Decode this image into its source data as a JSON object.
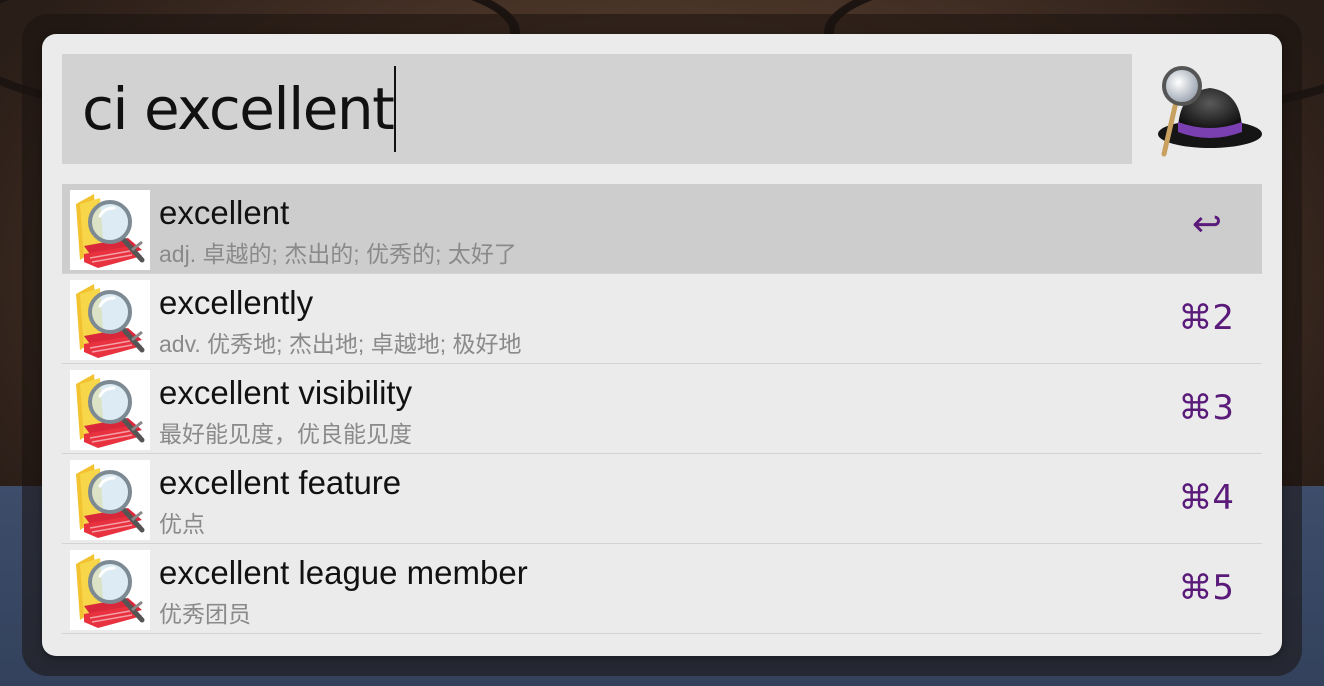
{
  "search": {
    "query": "ci excellent"
  },
  "app_logo": {
    "icon": "alfred-hat-icon"
  },
  "results": [
    {
      "title": "excellent",
      "subtitle": "adj. 卓越的; 杰出的; 优秀的; 太好了",
      "shortcut": "↩",
      "selected": true,
      "icon": "dictionary-icon"
    },
    {
      "title": "excellently",
      "subtitle": "adv. 优秀地; 杰出地; 卓越地; 极好地",
      "shortcut": "⌘2",
      "selected": false,
      "icon": "dictionary-icon"
    },
    {
      "title": "excellent visibility",
      "subtitle": "最好能见度，优良能见度",
      "shortcut": "⌘3",
      "selected": false,
      "icon": "dictionary-icon"
    },
    {
      "title": "excellent feature",
      "subtitle": "优点",
      "shortcut": "⌘4",
      "selected": false,
      "icon": "dictionary-icon"
    },
    {
      "title": "excellent league member",
      "subtitle": "优秀团员",
      "shortcut": "⌘5",
      "selected": false,
      "icon": "dictionary-icon"
    }
  ],
  "colors": {
    "window_bg": "#ebebeb",
    "search_bg": "#d2d2d2",
    "selected_row_bg": "#cdcdcd",
    "shortcut": "#5a1a7a",
    "subtitle": "#8a8a8a"
  }
}
